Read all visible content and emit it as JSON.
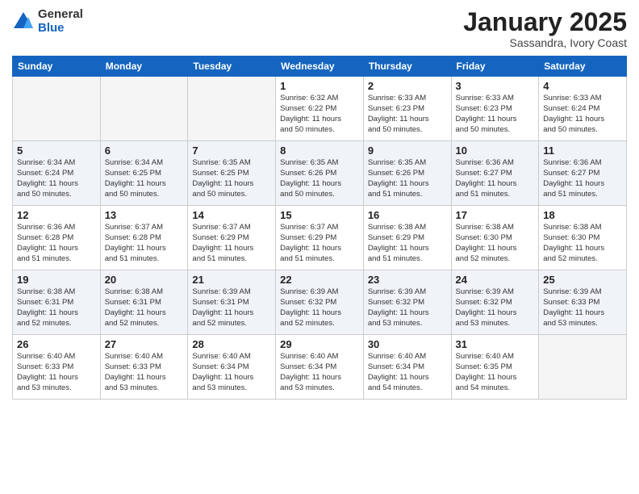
{
  "logo": {
    "general": "General",
    "blue": "Blue"
  },
  "title": "January 2025",
  "subtitle": "Sassandra, Ivory Coast",
  "days_header": [
    "Sunday",
    "Monday",
    "Tuesday",
    "Wednesday",
    "Thursday",
    "Friday",
    "Saturday"
  ],
  "weeks": [
    [
      {
        "day": "",
        "info": ""
      },
      {
        "day": "",
        "info": ""
      },
      {
        "day": "",
        "info": ""
      },
      {
        "day": "1",
        "info": "Sunrise: 6:32 AM\nSunset: 6:22 PM\nDaylight: 11 hours\nand 50 minutes."
      },
      {
        "day": "2",
        "info": "Sunrise: 6:33 AM\nSunset: 6:23 PM\nDaylight: 11 hours\nand 50 minutes."
      },
      {
        "day": "3",
        "info": "Sunrise: 6:33 AM\nSunset: 6:23 PM\nDaylight: 11 hours\nand 50 minutes."
      },
      {
        "day": "4",
        "info": "Sunrise: 6:33 AM\nSunset: 6:24 PM\nDaylight: 11 hours\nand 50 minutes."
      }
    ],
    [
      {
        "day": "5",
        "info": "Sunrise: 6:34 AM\nSunset: 6:24 PM\nDaylight: 11 hours\nand 50 minutes."
      },
      {
        "day": "6",
        "info": "Sunrise: 6:34 AM\nSunset: 6:25 PM\nDaylight: 11 hours\nand 50 minutes."
      },
      {
        "day": "7",
        "info": "Sunrise: 6:35 AM\nSunset: 6:25 PM\nDaylight: 11 hours\nand 50 minutes."
      },
      {
        "day": "8",
        "info": "Sunrise: 6:35 AM\nSunset: 6:26 PM\nDaylight: 11 hours\nand 50 minutes."
      },
      {
        "day": "9",
        "info": "Sunrise: 6:35 AM\nSunset: 6:26 PM\nDaylight: 11 hours\nand 51 minutes."
      },
      {
        "day": "10",
        "info": "Sunrise: 6:36 AM\nSunset: 6:27 PM\nDaylight: 11 hours\nand 51 minutes."
      },
      {
        "day": "11",
        "info": "Sunrise: 6:36 AM\nSunset: 6:27 PM\nDaylight: 11 hours\nand 51 minutes."
      }
    ],
    [
      {
        "day": "12",
        "info": "Sunrise: 6:36 AM\nSunset: 6:28 PM\nDaylight: 11 hours\nand 51 minutes."
      },
      {
        "day": "13",
        "info": "Sunrise: 6:37 AM\nSunset: 6:28 PM\nDaylight: 11 hours\nand 51 minutes."
      },
      {
        "day": "14",
        "info": "Sunrise: 6:37 AM\nSunset: 6:29 PM\nDaylight: 11 hours\nand 51 minutes."
      },
      {
        "day": "15",
        "info": "Sunrise: 6:37 AM\nSunset: 6:29 PM\nDaylight: 11 hours\nand 51 minutes."
      },
      {
        "day": "16",
        "info": "Sunrise: 6:38 AM\nSunset: 6:29 PM\nDaylight: 11 hours\nand 51 minutes."
      },
      {
        "day": "17",
        "info": "Sunrise: 6:38 AM\nSunset: 6:30 PM\nDaylight: 11 hours\nand 52 minutes."
      },
      {
        "day": "18",
        "info": "Sunrise: 6:38 AM\nSunset: 6:30 PM\nDaylight: 11 hours\nand 52 minutes."
      }
    ],
    [
      {
        "day": "19",
        "info": "Sunrise: 6:38 AM\nSunset: 6:31 PM\nDaylight: 11 hours\nand 52 minutes."
      },
      {
        "day": "20",
        "info": "Sunrise: 6:38 AM\nSunset: 6:31 PM\nDaylight: 11 hours\nand 52 minutes."
      },
      {
        "day": "21",
        "info": "Sunrise: 6:39 AM\nSunset: 6:31 PM\nDaylight: 11 hours\nand 52 minutes."
      },
      {
        "day": "22",
        "info": "Sunrise: 6:39 AM\nSunset: 6:32 PM\nDaylight: 11 hours\nand 52 minutes."
      },
      {
        "day": "23",
        "info": "Sunrise: 6:39 AM\nSunset: 6:32 PM\nDaylight: 11 hours\nand 53 minutes."
      },
      {
        "day": "24",
        "info": "Sunrise: 6:39 AM\nSunset: 6:32 PM\nDaylight: 11 hours\nand 53 minutes."
      },
      {
        "day": "25",
        "info": "Sunrise: 6:39 AM\nSunset: 6:33 PM\nDaylight: 11 hours\nand 53 minutes."
      }
    ],
    [
      {
        "day": "26",
        "info": "Sunrise: 6:40 AM\nSunset: 6:33 PM\nDaylight: 11 hours\nand 53 minutes."
      },
      {
        "day": "27",
        "info": "Sunrise: 6:40 AM\nSunset: 6:33 PM\nDaylight: 11 hours\nand 53 minutes."
      },
      {
        "day": "28",
        "info": "Sunrise: 6:40 AM\nSunset: 6:34 PM\nDaylight: 11 hours\nand 53 minutes."
      },
      {
        "day": "29",
        "info": "Sunrise: 6:40 AM\nSunset: 6:34 PM\nDaylight: 11 hours\nand 53 minutes."
      },
      {
        "day": "30",
        "info": "Sunrise: 6:40 AM\nSunset: 6:34 PM\nDaylight: 11 hours\nand 54 minutes."
      },
      {
        "day": "31",
        "info": "Sunrise: 6:40 AM\nSunset: 6:35 PM\nDaylight: 11 hours\nand 54 minutes."
      },
      {
        "day": "",
        "info": ""
      }
    ]
  ]
}
